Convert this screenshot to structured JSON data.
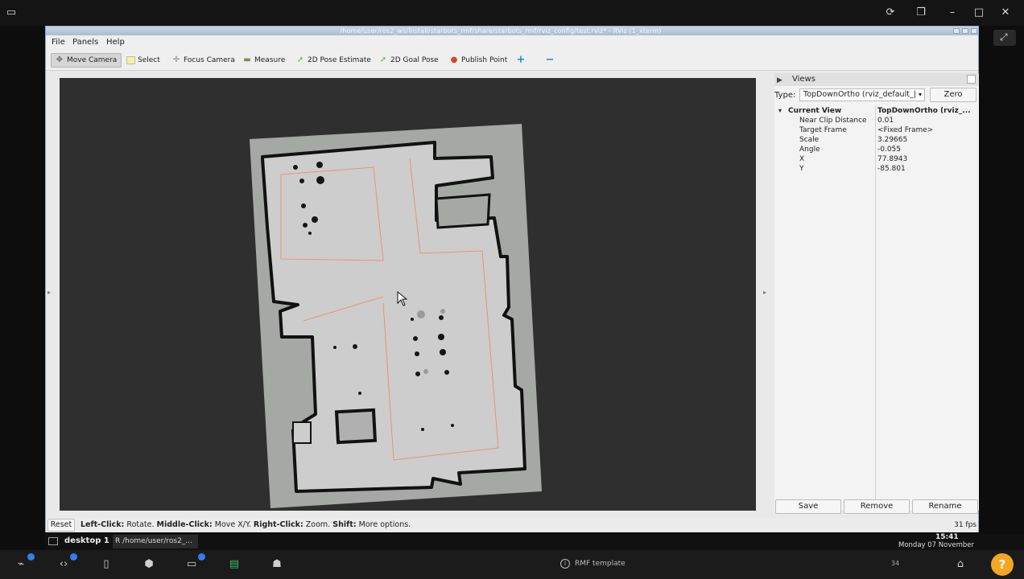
{
  "window": {
    "title": "/home/user/ros2_ws/install/starbots_rmf/share/starbots_rmf/rviz_config/test.rviz* - RViz (1_xterm)"
  },
  "menu": [
    "File",
    "Panels",
    "Help"
  ],
  "toolbar": {
    "move_camera": "Move Camera",
    "select": "Select",
    "focus_camera": "Focus Camera",
    "measure": "Measure",
    "pose_estimate": "2D Pose Estimate",
    "goal_pose": "2D Goal Pose",
    "publish_point": "Publish Point"
  },
  "views": {
    "title": "Views",
    "type_label": "Type:",
    "type_value": "TopDownOrtho (rviz_default_|",
    "zero_button": "Zero",
    "current_view_label": "Current View",
    "current_view_value": "TopDownOrtho (rviz_...",
    "properties": [
      {
        "key": "Near Clip Distance",
        "value": "0.01"
      },
      {
        "key": "Target Frame",
        "value": "<Fixed Frame>"
      },
      {
        "key": "Scale",
        "value": "3.29665"
      },
      {
        "key": "Angle",
        "value": "-0.055"
      },
      {
        "key": "X",
        "value": "77.8943"
      },
      {
        "key": "Y",
        "value": "-85.801"
      }
    ],
    "save_button": "Save",
    "remove_button": "Remove",
    "rename_button": "Rename"
  },
  "status": {
    "reset_button": "Reset",
    "left_click": "Left-Click:",
    "left_click_desc": "Rotate.",
    "middle_click": "Middle-Click:",
    "middle_click_desc": "Move X/Y.",
    "right_click": "Right-Click:",
    "right_click_desc": "Zoom.",
    "shift": "Shift:",
    "shift_desc": "More options.",
    "fps": "31 fps"
  },
  "desktop": {
    "label": "desktop 1",
    "task": "/home/user/ros2_...",
    "time": "15:41",
    "date": "Monday 07 November",
    "center_label": "RMF template",
    "count": "34"
  },
  "colors": {
    "map_free": "#cdcdcd",
    "map_unknown": "#a6a8a6",
    "lane": "#e8956f",
    "accent": "#2f80ed",
    "help": "#f5a623"
  }
}
